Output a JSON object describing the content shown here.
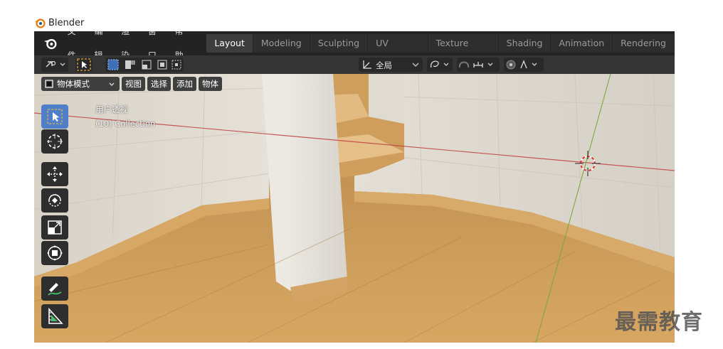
{
  "window": {
    "title": "Blender"
  },
  "menu": {
    "items": [
      "文件",
      "编辑",
      "渲染",
      "窗口",
      "帮助"
    ]
  },
  "workspaces": {
    "tabs": [
      "Layout",
      "Modeling",
      "Sculpting",
      "UV Editing",
      "Texture Paint",
      "Shading",
      "Animation",
      "Rendering"
    ],
    "active": "Layout"
  },
  "tool_header": {
    "transform_orientation": "全局"
  },
  "viewport_header": {
    "mode": "物体模式",
    "menus": [
      "视图",
      "选择",
      "添加",
      "物体"
    ]
  },
  "overlay": {
    "view_name": "用户透视",
    "collection": "(10) Collection"
  },
  "tools": [
    "select-box-icon",
    "cursor-icon",
    "move-icon",
    "rotate-icon",
    "scale-icon",
    "transform-icon",
    "annotate-icon",
    "measure-icon"
  ],
  "colors": {
    "accent": "#4f7fc9",
    "floor": "#c99a5a",
    "wall": "#e8e4dc"
  },
  "watermark": "最需教育"
}
